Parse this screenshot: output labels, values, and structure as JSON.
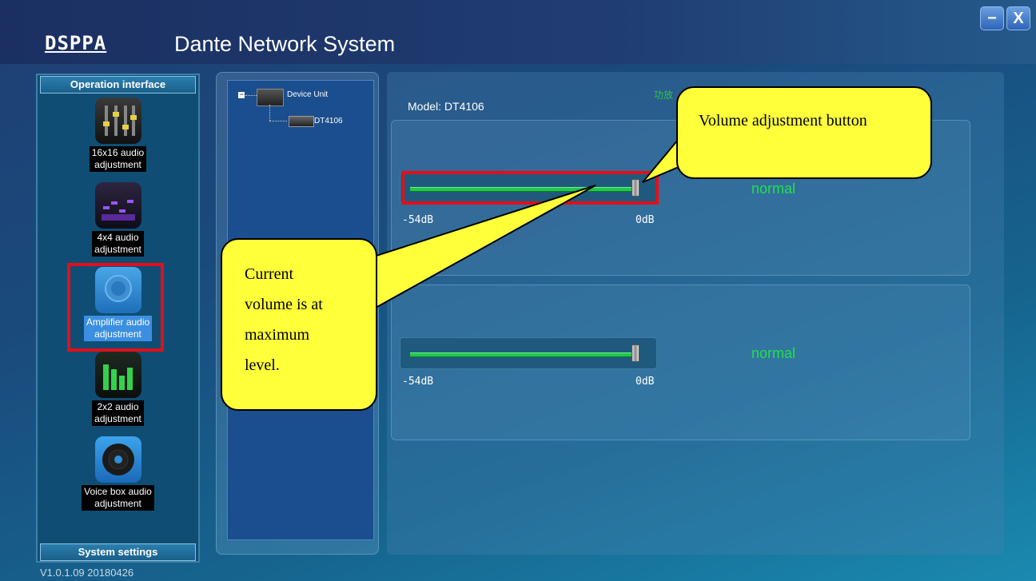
{
  "header": {
    "logo": "DSPPA",
    "title": "Dante Network System",
    "minimize": "−",
    "close": "X"
  },
  "sidebar": {
    "header": "Operation interface",
    "items": [
      {
        "label_line1": "16x16 audio",
        "label_line2": "adjustment"
      },
      {
        "label_line1": "4x4 audio",
        "label_line2": "adjustment"
      },
      {
        "label_line1": "Amplifier audio",
        "label_line2": "adjustment"
      },
      {
        "label_line1": "2x2 audio",
        "label_line2": "adjustment"
      },
      {
        "label_line1": "Voice box audio",
        "label_line2": "adjustment"
      }
    ],
    "footer": "System settings"
  },
  "tree": {
    "root_toggle": "−",
    "root": "Device Unit",
    "child": "DT4106"
  },
  "main": {
    "model": "Model: DT4106",
    "cjk_label": "功放",
    "channels": [
      {
        "min_label": "-54dB",
        "max_label": "0dB",
        "status": "normal",
        "level": 1.0
      },
      {
        "min_label": "-54dB",
        "max_label": "0dB",
        "status": "normal",
        "level": 1.0
      }
    ]
  },
  "callouts": {
    "button": "Volume adjustment button",
    "current_line1": "Current",
    "current_line2": "volume is at",
    "current_line3": "maximum",
    "current_line4": "level."
  },
  "version": "V1.0.1.09  20180426",
  "colors": {
    "accent_green": "#22e04a",
    "highlight_red": "#e0101a",
    "callout_yellow": "#ffff3a"
  }
}
